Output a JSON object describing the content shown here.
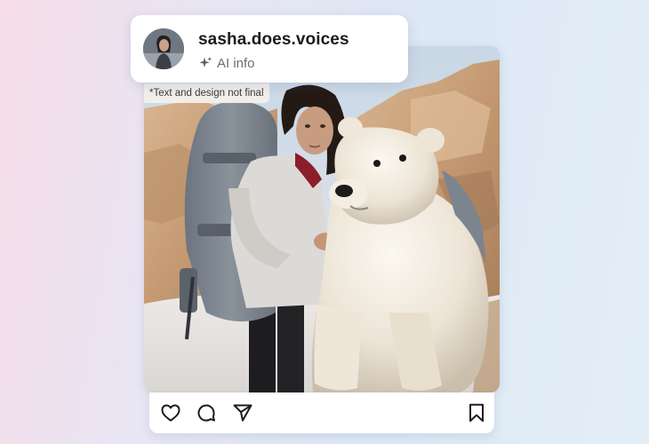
{
  "profile": {
    "username": "sasha.does.voices",
    "ai_label": "AI info",
    "avatar_icon": "user-avatar"
  },
  "disclaimer": "*Text and design not final",
  "photo": {
    "subject_icon": "woman-with-backpack-and-polar-bear-photo"
  },
  "actions": {
    "like_icon": "heart-icon",
    "comment_icon": "comment-icon",
    "share_icon": "send-icon",
    "save_icon": "bookmark-icon"
  },
  "colors": {
    "text_primary": "#1c1c1e",
    "text_secondary": "#6b6f76",
    "card_bg": "#ffffff"
  }
}
